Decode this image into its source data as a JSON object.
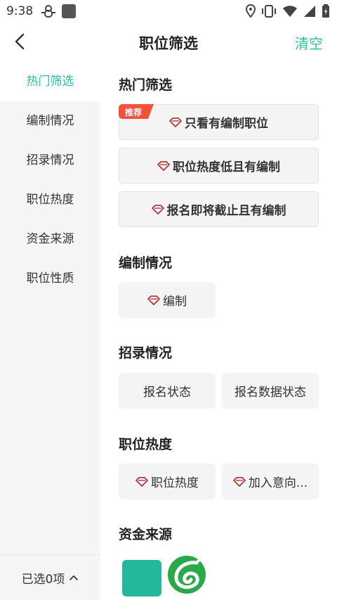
{
  "status": {
    "time": "9:38",
    "icons": [
      "debug-icon",
      "square-icon",
      "location-icon",
      "vibrate-icon",
      "wifi-icon",
      "signal-icon",
      "battery-icon"
    ]
  },
  "header": {
    "title": "职位筛选",
    "clear_label": "清空"
  },
  "sidebar": {
    "items": [
      {
        "label": "热门筛选",
        "active": true
      },
      {
        "label": "编制情况",
        "active": false
      },
      {
        "label": "招录情况",
        "active": false
      },
      {
        "label": "职位热度",
        "active": false
      },
      {
        "label": "资金来源",
        "active": false
      },
      {
        "label": "职位性质",
        "active": false
      }
    ]
  },
  "sections": {
    "hot": {
      "title": "热门筛选",
      "badge": "推荐",
      "options": [
        "只看有编制职位",
        "职位热度低且有编制",
        "报名即将截止且有编制"
      ]
    },
    "staffing": {
      "title": "编制情况",
      "options": [
        "编制"
      ]
    },
    "recruit": {
      "title": "招录情况",
      "options": [
        "报名状态",
        "报名数据状态"
      ]
    },
    "heat": {
      "title": "职位热度",
      "options": [
        "职位热度",
        "加入意向..."
      ]
    },
    "funding": {
      "title": "资金来源"
    }
  },
  "bottom": {
    "selected_label": "已选0项"
  },
  "colors": {
    "accent": "#2ebf9c",
    "badge": "#f4513a",
    "gem": "#b33a3a",
    "button_bg": "#f4f4f4"
  }
}
